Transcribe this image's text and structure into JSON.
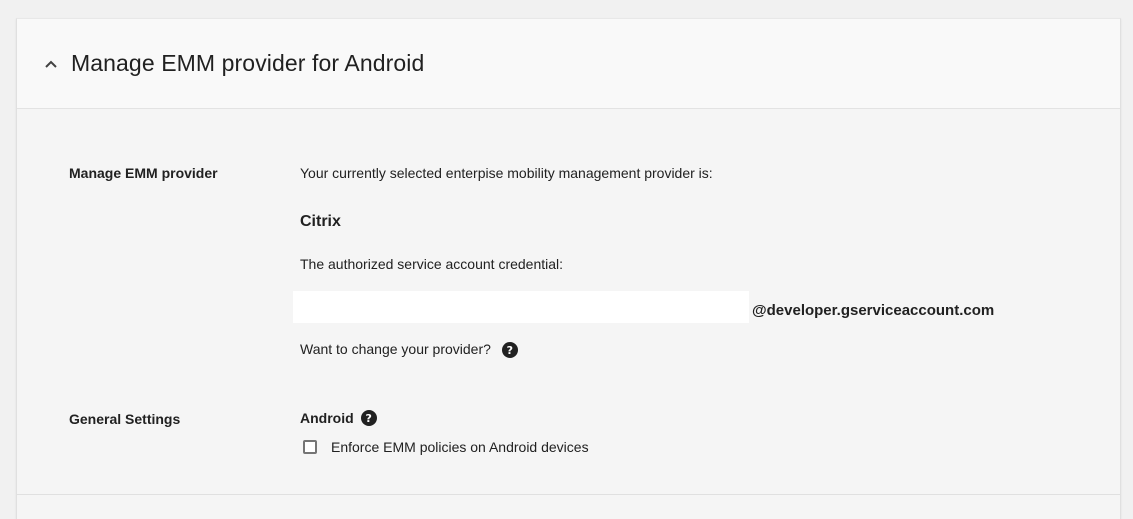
{
  "section": {
    "title": "Manage EMM provider for Android",
    "expanded": true,
    "chevron_icon": "chevron-up-icon"
  },
  "manage_emm": {
    "label": "Manage EMM provider",
    "intro_text": "Your currently selected enterpise mobility management provider is:",
    "provider_name": "Citrix",
    "credential_label": "The authorized service account credential:",
    "credential_value": "",
    "credential_suffix": "@developer.gserviceaccount.com",
    "change_provider_text": "Want to change your provider?",
    "help_icon": "help-icon",
    "help_glyph": "?"
  },
  "general_settings": {
    "label": "General Settings",
    "android_heading": "Android",
    "help_icon": "help-icon",
    "help_glyph": "?",
    "enforce_checkbox_label": "Enforce EMM policies on Android devices",
    "enforce_checked": false
  }
}
